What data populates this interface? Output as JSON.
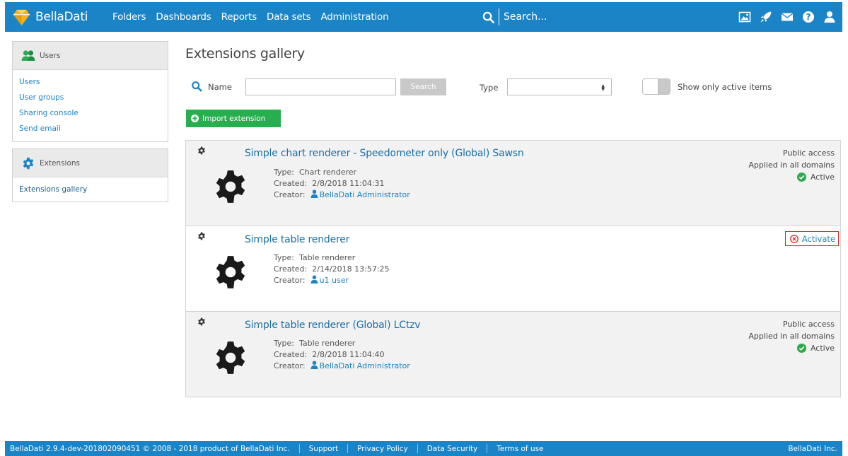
{
  "topbar": {
    "brand": "BellaDati",
    "nav": [
      "Folders",
      "Dashboards",
      "Reports",
      "Data sets",
      "Administration"
    ],
    "search_placeholder": "Search...",
    "icons": [
      "image-icon",
      "rocket-icon",
      "envelope-icon",
      "help-icon",
      "user-icon"
    ]
  },
  "sidebar": {
    "users_panel": {
      "title": "Users",
      "links": [
        "Users",
        "User groups",
        "Sharing console",
        "Send email"
      ]
    },
    "extensions_panel": {
      "title": "Extensions",
      "links": [
        "Extensions gallery"
      ]
    }
  },
  "main": {
    "title": "Extensions gallery",
    "filter": {
      "name_label": "Name",
      "name_value": "",
      "search_button": "Search",
      "type_label": "Type",
      "type_value": "",
      "toggle_label": "Show only active items",
      "toggle_on": false
    },
    "import_button": "Import extension",
    "extensions": [
      {
        "title": "Simple chart renderer - Speedometer only (Global) Sawsn",
        "type_label": "Type:",
        "type": "Chart renderer",
        "created_label": "Created:",
        "created": "2/8/2018 11:04:31",
        "creator_label": "Creator:",
        "creator": "BellaDati Administrator",
        "access": "Public access",
        "domains": "Applied in all domains",
        "status": "Active"
      },
      {
        "title": "Simple table renderer",
        "type_label": "Type:",
        "type": "Table renderer",
        "created_label": "Created:",
        "created": "2/14/2018 13:57:25",
        "creator_label": "Creator:",
        "creator": "u1 user",
        "action": "Activate"
      },
      {
        "title": "Simple table renderer (Global) LCtzv",
        "type_label": "Type:",
        "type": "Table renderer",
        "created_label": "Created:",
        "created": "2/8/2018 11:04:40",
        "creator_label": "Creator:",
        "creator": "BellaDati Administrator",
        "access": "Public access",
        "domains": "Applied in all domains",
        "status": "Active"
      }
    ]
  },
  "footer": {
    "copyright": "BellaDati 2.9.4-dev-201802090451 © 2008 - 2018 product of BellaDati Inc.",
    "links": [
      "Support",
      "Privacy Policy",
      "Data Security",
      "Terms of use"
    ],
    "right": "BellaDati Inc."
  },
  "colors": {
    "primary": "#1a84c6",
    "success": "#27ae4f",
    "active_check": "#2eaa4b",
    "activate_icon": "#e0262e",
    "highlight_border": "#e0262e"
  }
}
